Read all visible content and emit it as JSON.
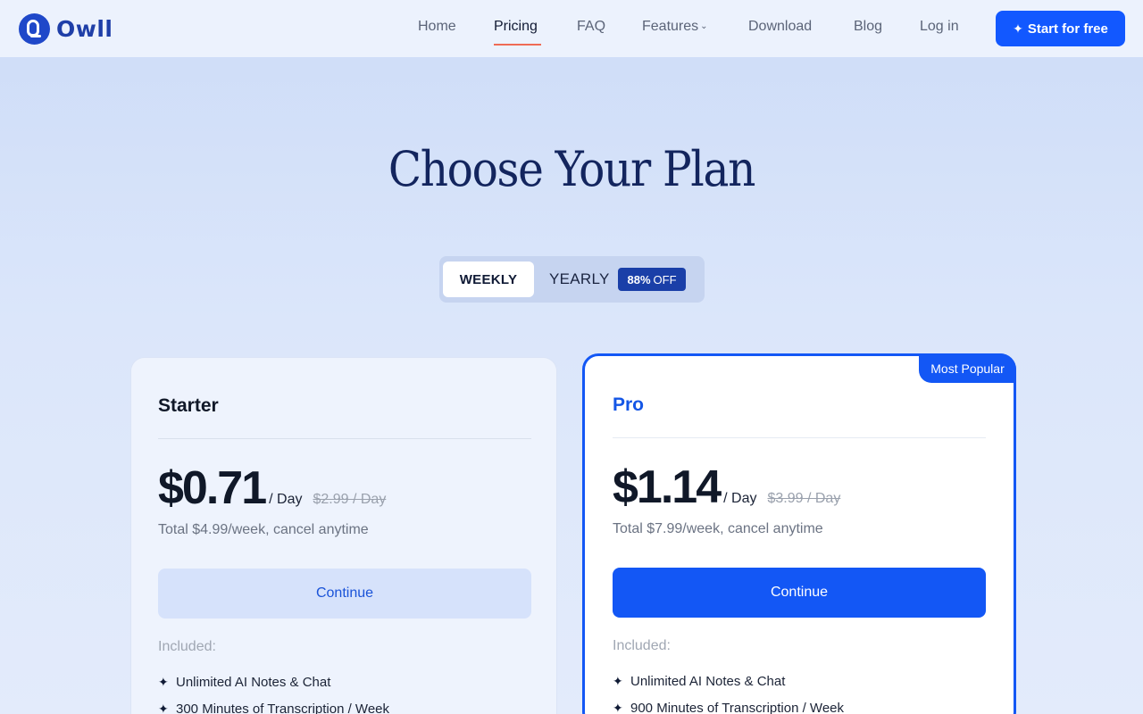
{
  "header": {
    "logo_text": "Owll",
    "nav": [
      "Home",
      "Pricing",
      "FAQ",
      "Features",
      "Download",
      "Blog",
      "Log in"
    ],
    "active_nav": "Pricing",
    "cta_label": "Start for free"
  },
  "hero": {
    "title": "Choose Your Plan"
  },
  "billing_toggle": {
    "weekly_label": "WEEKLY",
    "yearly_label": "YEARLY",
    "badge_value": "88%",
    "badge_suffix": "OFF",
    "selected": "WEEKLY"
  },
  "plans": [
    {
      "name": "Starter",
      "price": "$0.71",
      "per": "/ Day",
      "old_price": "$2.99 / Day",
      "total": "Total $4.99/week, cancel anytime",
      "button": "Continue",
      "included_label": "Included:",
      "features": [
        "Unlimited AI Notes & Chat",
        "300 Minutes of Transcription / Week"
      ]
    },
    {
      "name": "Pro",
      "badge": "Most Popular",
      "price": "$1.14",
      "per": "/ Day",
      "old_price": "$3.99 / Day",
      "total": "Total $7.99/week, cancel anytime",
      "button": "Continue",
      "included_label": "Included:",
      "features": [
        "Unlimited AI Notes & Chat",
        "900 Minutes of Transcription / Week"
      ]
    }
  ],
  "colors": {
    "accent": "#1357f5",
    "brand": "#1f48c9",
    "underline": "#ef6b55"
  }
}
